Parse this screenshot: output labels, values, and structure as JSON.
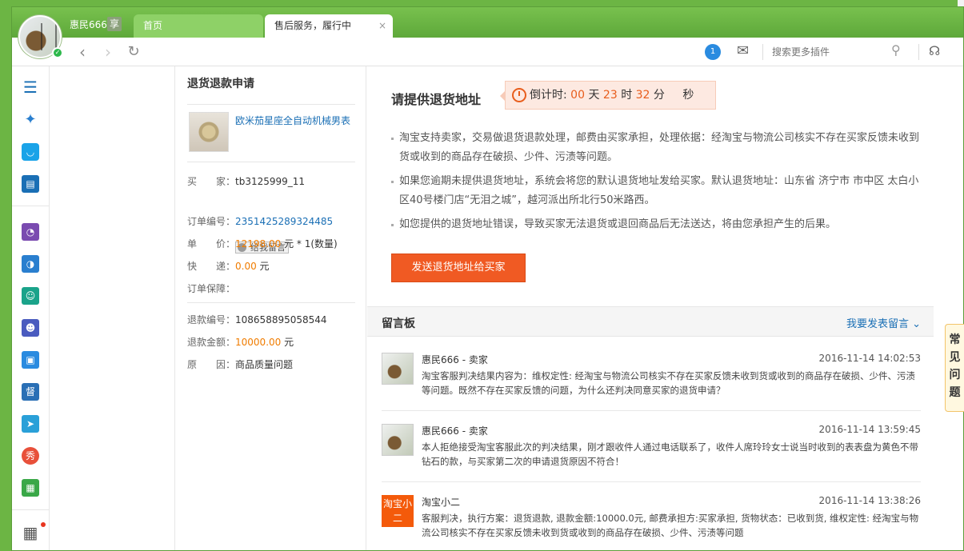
{
  "titlebar": {
    "username": "惠民666",
    "vip_badge": "享",
    "tabs": [
      {
        "label": "首页"
      },
      {
        "label": "售后服务，履行中",
        "close": "×"
      }
    ]
  },
  "toolbar": {
    "back_icon": "‹",
    "forward_icon": "›",
    "refresh_icon": "↻",
    "notify_badge": "1",
    "search_placeholder": "搜索更多插件"
  },
  "sidebar": {
    "icons": [
      "list-icon",
      "pinwheel-icon",
      "bag-icon",
      "card-icon",
      "chart-icon",
      "gauge-icon",
      "people-icon",
      "person-icon",
      "clipboard-icon",
      "supervise-icon",
      "send-icon",
      "show-icon",
      "calendar-icon",
      "apps-icon"
    ],
    "supervise_label": "督",
    "show_label": "秀"
  },
  "order": {
    "title": "退货退款申请",
    "product_name": "欧米茄星座全自动机械男表",
    "buyer_label": "买　　家：",
    "buyer": "tb3125999_11",
    "message_button": "给我留言",
    "order_no_label": "订单编号：",
    "order_no": "2351425289324485",
    "price_label": "单　　价：",
    "price": "12198.00",
    "price_unit": " 元 * 1(数量)",
    "shipping_label": "快　　递：",
    "shipping": "0.00",
    "shipping_unit": " 元",
    "protection_label": "订单保障：",
    "refund_no_label": "退款编号：",
    "refund_no": "108658895058544",
    "refund_amount_label": "退款金额：",
    "refund_amount": "10000.00",
    "refund_amount_unit": " 元",
    "reason_label": "原　　因：",
    "reason": "商品质量问题"
  },
  "main": {
    "title": "请提供退货地址",
    "countdown": {
      "label": "倒计时:",
      "days": "00",
      "days_unit": "天",
      "hours": "23",
      "hours_unit": "时",
      "minutes": "32",
      "minutes_unit": "分",
      "seconds_unit": "秒"
    },
    "bullets": [
      "淘宝支持卖家，交易做退货退款处理，邮费由买家承担，处理依据：经淘宝与物流公司核实不存在买家反馈未收到货或收到的商品存在破损、少件、污渍等问题。",
      "如果您逾期未提供退货地址，系统会将您的默认退货地址发给买家。默认退货地址：山东省 济宁市 市中区 太白小区40号楼门店“无泪之城”，越河派出所北行50米路西。",
      "如您提供的退货地址错误，导致买家无法退货或退回商品后无法送达，将由您承担产生的后果。"
    ],
    "send_button": "发送退货地址给买家"
  },
  "board": {
    "title": "留言板",
    "post_link": "我要发表留言",
    "comments": [
      {
        "name": "惠民666 - 卖家",
        "time": "2016-11-14 14:02:53",
        "text": "淘宝客服判决结果内容为：维权定性: 经淘宝与物流公司核实不存在买家反馈未收到货或收到的商品存在破损、少件、污渍等问题。既然不存在买家反馈的问题，为什么还判决同意买家的退货申请？"
      },
      {
        "name": "惠民666 - 卖家",
        "time": "2016-11-14 13:59:45",
        "text": "本人拒绝接受淘宝客服此次的判决结果，刚才跟收件人通过电话联系了，收件人席玲玲女士说当时收到的表表盘为黄色不带钻石的款，与买家第二次的申请退货原因不符合！"
      },
      {
        "name": "淘宝小二",
        "time": "2016-11-14 13:38:26",
        "text": "客服判决，执行方案：退货退款, 退款金额:10000.0元, 邮费承担方:买家承担, 货物状态：已收到货, 维权定性: 经淘宝与物流公司核实不存在买家反馈未收到货或收到的商品存在破损、少件、污渍等问题",
        "avatar_text": "淘宝小二"
      }
    ]
  },
  "float_help": "常见问题",
  "colors": {
    "brand_green": "#6cb544",
    "accent_orange": "#f05a23",
    "link_blue": "#1a6fb5"
  }
}
